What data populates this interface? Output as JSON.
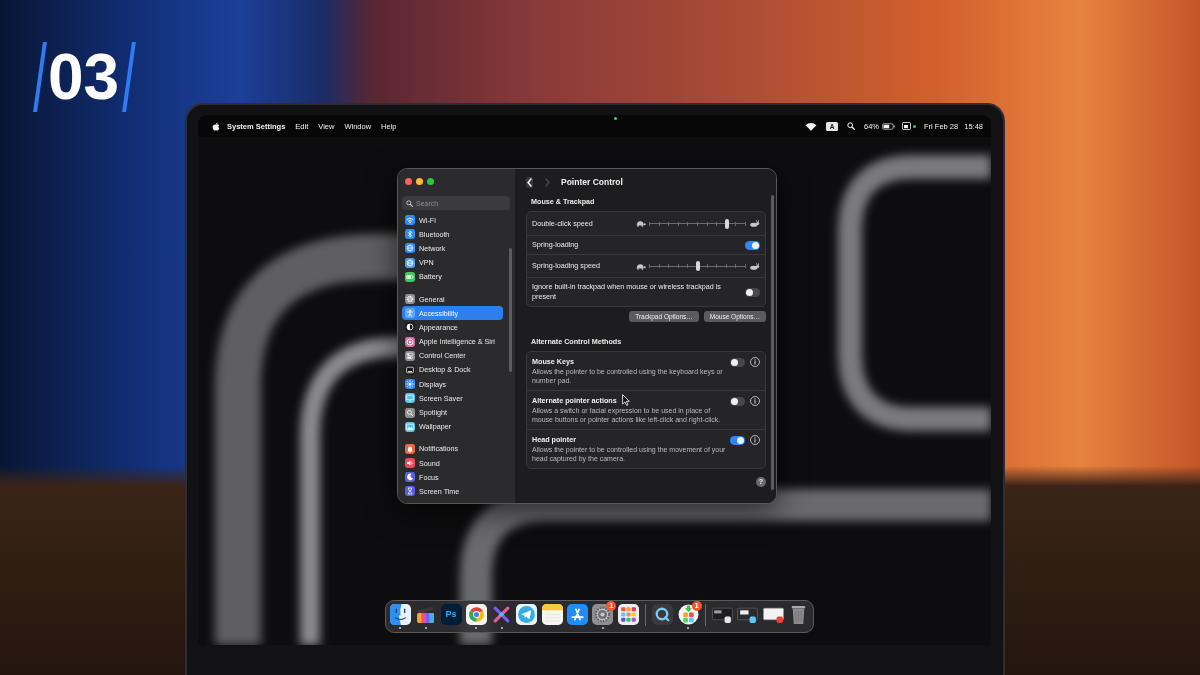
{
  "episode_badge": {
    "text": "03"
  },
  "menu_bar": {
    "app_name": "System Settings",
    "menus": [
      "Edit",
      "View",
      "Window",
      "Help"
    ],
    "input_source": "A",
    "battery": "64%",
    "date": "Fri Feb 28",
    "time": "15:48"
  },
  "settings_window": {
    "search": {
      "placeholder": "Search"
    },
    "sidebar_groups": [
      {
        "items": [
          {
            "label": "Wi-Fi",
            "selected": false,
            "color": "#2f8cf5"
          },
          {
            "label": "Bluetooth",
            "selected": false,
            "color": "#2f8cf5"
          },
          {
            "label": "Network",
            "selected": false,
            "color": "#2f8cf5"
          },
          {
            "label": "VPN",
            "selected": false,
            "color": "#4a9fe8"
          },
          {
            "label": "Battery",
            "selected": false,
            "color": "#43c85c"
          }
        ]
      },
      {
        "items": [
          {
            "label": "General",
            "selected": false,
            "color": "#8e8e93"
          },
          {
            "label": "Accessibility",
            "selected": true,
            "color": "#5aa8f8"
          },
          {
            "label": "Appearance",
            "selected": false,
            "color": "#1c1c1e"
          },
          {
            "label": "Apple Intelligence & Siri",
            "selected": false,
            "color": "#d96a9c"
          },
          {
            "label": "Control Center",
            "selected": false,
            "color": "#8e8e93"
          },
          {
            "label": "Desktop & Dock",
            "selected": false,
            "color": "#1c1c1e"
          },
          {
            "label": "Displays",
            "selected": false,
            "color": "#2f8cf5"
          },
          {
            "label": "Screen Saver",
            "selected": false,
            "color": "#56c2e6"
          },
          {
            "label": "Spotlight",
            "selected": false,
            "color": "#8e8e93"
          },
          {
            "label": "Wallpaper",
            "selected": false,
            "color": "#56c2e6"
          }
        ]
      },
      {
        "items": [
          {
            "label": "Notifications",
            "selected": false,
            "color": "#f0663c"
          },
          {
            "label": "Sound",
            "selected": false,
            "color": "#ee4a5c"
          },
          {
            "label": "Focus",
            "selected": false,
            "color": "#5b5fe0"
          },
          {
            "label": "Screen Time",
            "selected": false,
            "color": "#5b5fe0"
          }
        ]
      }
    ],
    "page": {
      "nav_buttons": [
        {
          "disabled": false
        },
        {
          "disabled": true
        }
      ],
      "title": "Pointer Control",
      "sections": [
        {
          "heading": "Mouse & Trackpad",
          "rows": [
            {
              "kind": "slider",
              "label": "Double-click speed",
              "level": 0.8
            },
            {
              "kind": "switch",
              "label": "Spring-loading",
              "on": true
            },
            {
              "kind": "slider",
              "label": "Spring-loading speed",
              "level": 0.5
            },
            {
              "kind": "switch",
              "label": "Ignore built-in trackpad when mouse or wireless trackpad is present",
              "on": false
            }
          ],
          "buttons": [
            "Trackpad Options…",
            "Mouse Options…"
          ]
        },
        {
          "heading": "Alternate Control Methods",
          "rows": [
            {
              "kind": "option",
              "label": "Mouse Keys",
              "description": "Allows the pointer to be controlled using the keyboard keys or number pad.",
              "on": false
            },
            {
              "kind": "option",
              "label": "Alternate pointer actions",
              "description": "Allows a switch or facial expression to be used in place of mouse buttons or pointer actions like left-click and right-click.",
              "on": false
            },
            {
              "kind": "option",
              "label": "Head pointer",
              "description": "Allows the pointer to be controlled using the movement of your head captured by the camera.",
              "on": true
            }
          ]
        }
      ],
      "help_button": "?"
    }
  },
  "dock": {
    "apps": [
      {
        "running": true
      },
      {
        "running": true
      },
      {
        "running": false,
        "label": "Ps"
      },
      {
        "running": true
      },
      {
        "running": true
      },
      {
        "running": false
      },
      {
        "running": false
      },
      {
        "running": false
      },
      {
        "running": true,
        "badge": "1"
      },
      {
        "running": false
      }
    ],
    "recent_apps": [
      {
        "running": false
      },
      {
        "running": true,
        "badge": "1"
      }
    ]
  }
}
